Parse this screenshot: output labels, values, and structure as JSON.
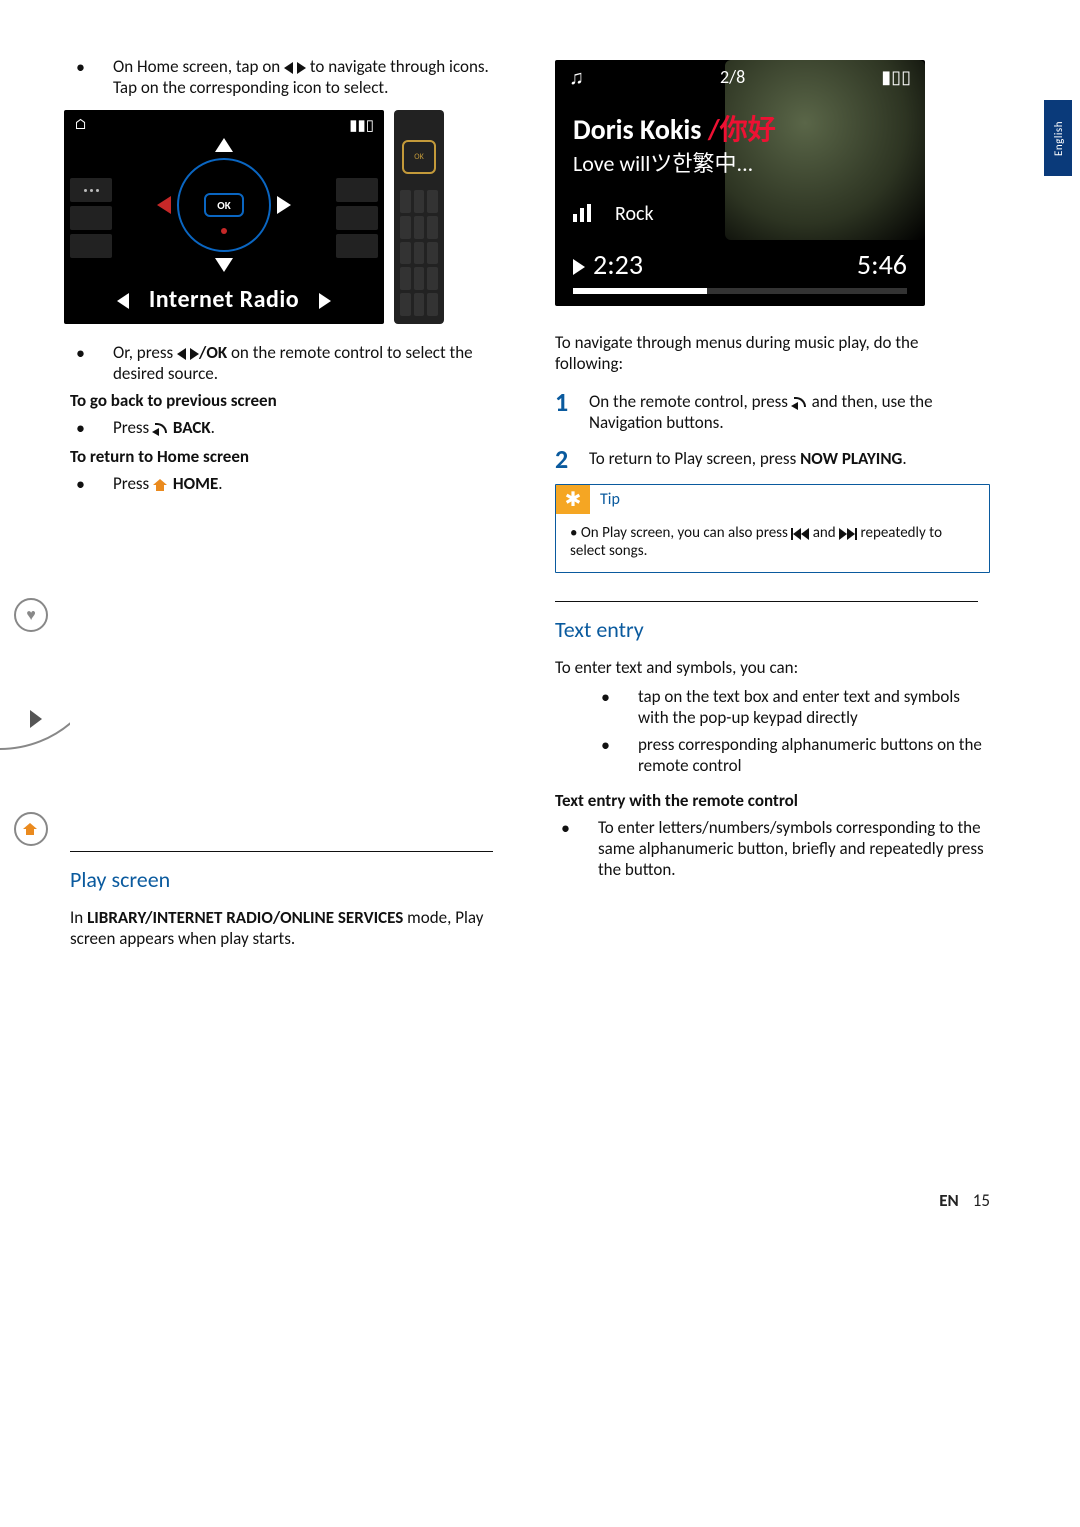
{
  "language_tab": "English",
  "left": {
    "bullets_top": {
      "item1_pre": "On Home screen, tap on ",
      "item1_post": " to navigate through icons. Tap on the corresponding icon to select."
    },
    "device_shot": {
      "bottom_label": "Internet Radio",
      "ok_label": "OK",
      "home_sym": "⌂",
      "signal_sym": "▮▮▯"
    },
    "bullets_mid": {
      "item1_pre": "Or, press ",
      "item1_ok": "/OK",
      "item1_post": " on the remote control to select the desired source."
    },
    "back_heading": "To go back to previous screen",
    "back_bullet_pre": "Press ",
    "back_bullet": "BACK",
    "home_heading": "To return to Home screen",
    "home_bullet_pre": "Press ",
    "home_bullet": "HOME",
    "play_heading": "Play screen",
    "play_para_pre": "In ",
    "play_para_bold": "LIBRARY/INTERNET RADIO/ONLINE SERVICES",
    "play_para_post": " mode, Play screen appears when play starts."
  },
  "right": {
    "playshot": {
      "counter": "2/8",
      "title_main": "Doris Kokis ",
      "title_red": "/你好",
      "title_sub": "Love willツ한繁中...",
      "genre": "Rock",
      "elapsed": "2:23",
      "total": "5:46",
      "note": "♫",
      "signal": "▮▯▯"
    },
    "nav_intro": "To navigate through menus during music play, do the following:",
    "step1_pre": "On the remote control, press ",
    "step1_post": " and then, use the Navigation buttons.",
    "step2_pre": "To return to Play screen, press ",
    "step2_bold": "NOW PLAYING",
    "tip_label": "Tip",
    "tip_body_pre": "On Play screen, you can also press ",
    "tip_body_mid": " and ",
    "tip_body_post": " repeatedly to select songs.",
    "text_entry_heading": "Text entry",
    "text_entry_intro": "To enter text and symbols, you can:",
    "te_b1": "tap on the text box and enter text and symbols with the pop-up keypad directly",
    "te_b2": "press corresponding alphanumeric buttons on the remote control",
    "te_sub": "Text entry with the remote control",
    "te_sub_bullet": "To enter letters/numbers/symbols corresponding to the same alphanumeric button, briefly and repeatedly press the button."
  },
  "footer": {
    "lang": "EN",
    "page": "15"
  }
}
